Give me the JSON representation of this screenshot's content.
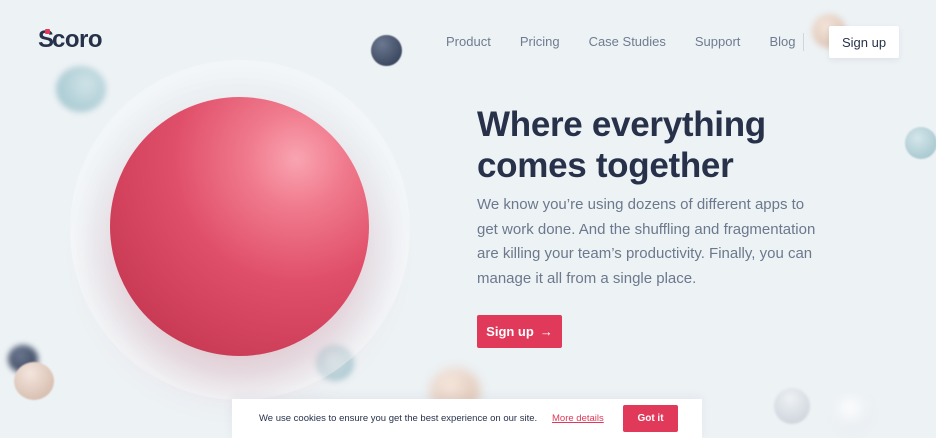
{
  "brand": {
    "name": "coro",
    "mark_letter": "S",
    "accent": "#e0395a"
  },
  "nav": {
    "items": [
      {
        "label": "Product"
      },
      {
        "label": "Pricing"
      },
      {
        "label": "Case Studies"
      },
      {
        "label": "Support"
      },
      {
        "label": "Blog"
      }
    ],
    "signup_label": "Sign up"
  },
  "hero": {
    "headline_line1": "Where everything",
    "headline_line2": "comes together",
    "description": "We know you’re using dozens of different apps to get work done. And the shuffling and fragmentation are killing your team’s productivity. Finally, you can manage it all from a single place.",
    "cta_label": "Sign up",
    "cta_icon": "arrow-right-icon"
  },
  "cookie": {
    "text": "We use cookies to ensure you get the best experience on our site.",
    "link_label": "More details",
    "button_label": "Got it"
  },
  "colors": {
    "background": "#edf2f5",
    "heading": "#27324a",
    "body_text": "#6c788c",
    "primary": "#e0395a"
  }
}
